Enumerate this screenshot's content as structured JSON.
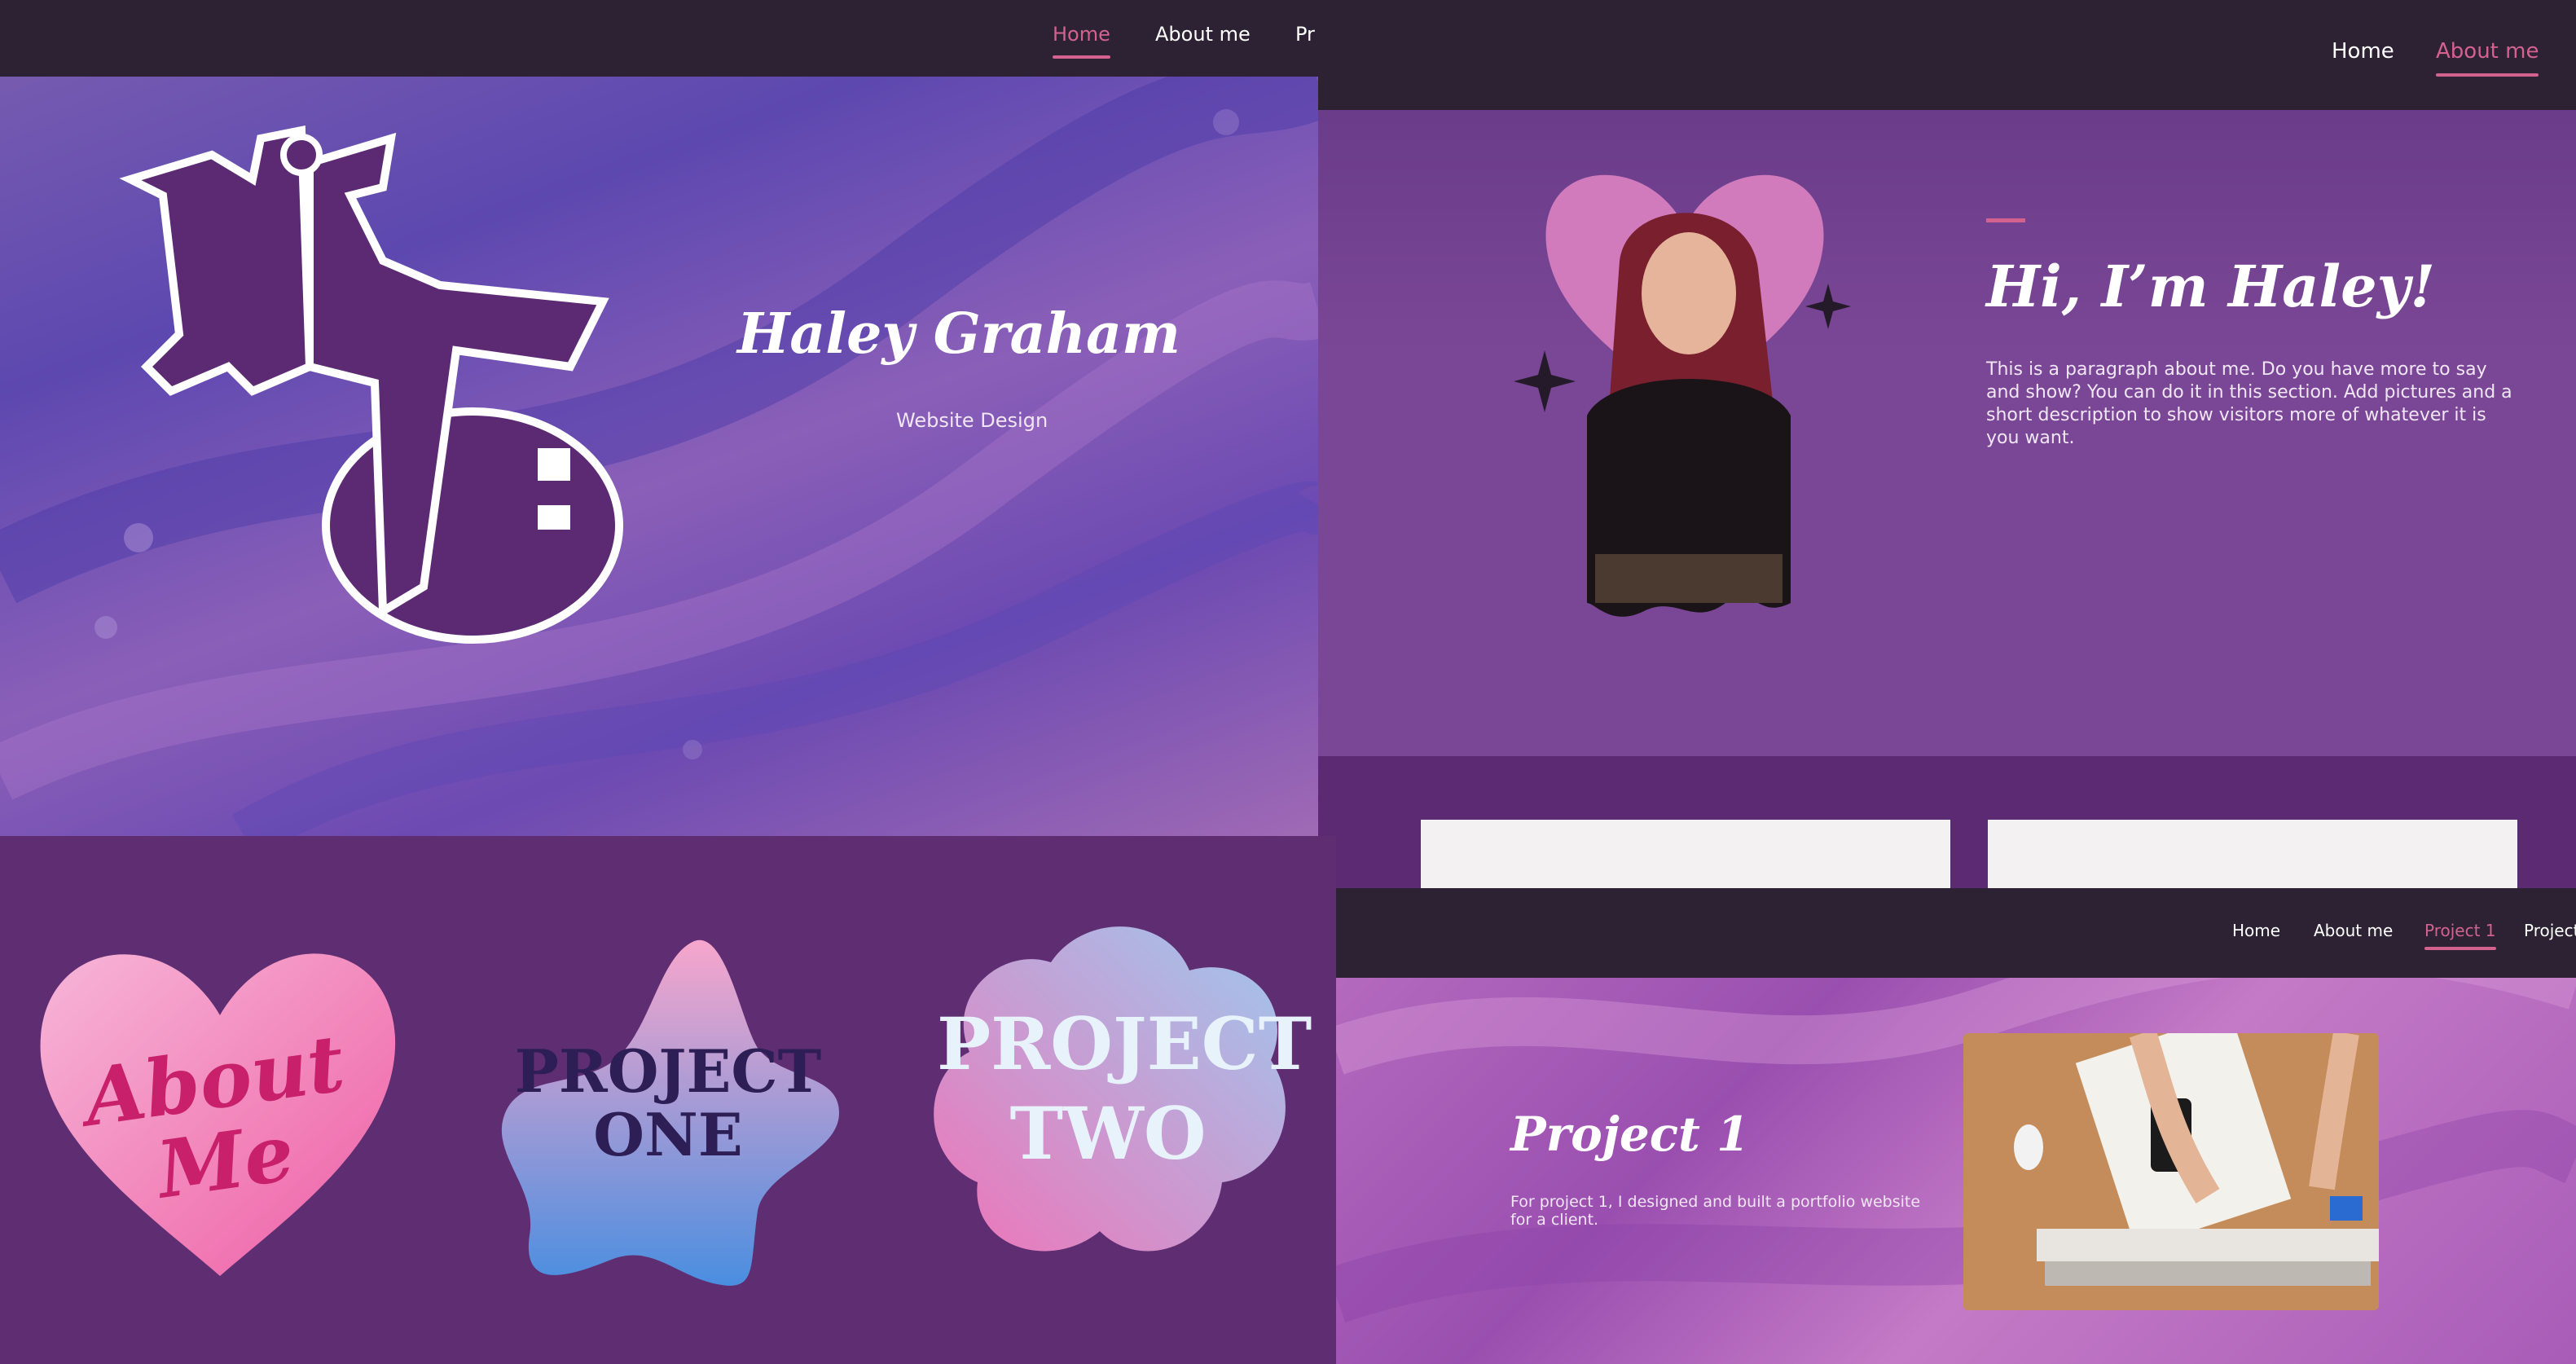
{
  "colors": {
    "accent": "#d3628f",
    "nav_bg": "#2c2233",
    "purple_dark": "#5a2a72",
    "purple_mid": "#6b3a86",
    "pink": "#f06aa8"
  },
  "home": {
    "nav": [
      "Home",
      "About me",
      "Pr"
    ],
    "active": 0,
    "name": "Haley Graham",
    "subtitle": "Website Design",
    "logo_text": "HG"
  },
  "about_page": {
    "nav": [
      "Home",
      "About me"
    ],
    "active": 1,
    "heading": "Hi, I’m Haley!",
    "paragraph": "This is a paragraph about me. Do you have more to say and show? You can do it in this section. Add pictures and a short description to show visitors more of whatever it is you want."
  },
  "stickers": {
    "about": "About Me",
    "project_one": "PROJECT ONE",
    "project_two": "PROJECT TWO"
  },
  "project_page": {
    "nav": [
      "Home",
      "About me",
      "Project 1",
      "Project"
    ],
    "active": 2,
    "heading": "Project 1",
    "paragraph": "For project 1, I designed and built a portfolio website for a client."
  }
}
